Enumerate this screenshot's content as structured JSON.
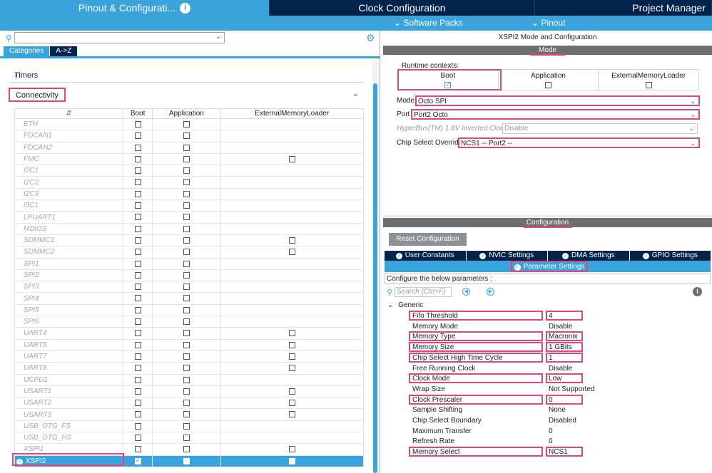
{
  "top_tabs": {
    "pinout": "Pinout & Configurati...",
    "clock": "Clock Configuration",
    "project": "Project Manager"
  },
  "sub_menu": {
    "software_packs": "Software Packs",
    "pinout": "Pinout"
  },
  "left": {
    "category_tabs": [
      "Categories",
      "A->Z"
    ],
    "timers": "Timers",
    "connectivity": "Connectivity",
    "table_headers": [
      "Boot",
      "Application",
      "ExternalMemoryLoader"
    ],
    "rows": [
      {
        "name": "ETH",
        "boot": 0,
        "app": 0,
        "ext": null
      },
      {
        "name": "FDCAN1",
        "boot": 0,
        "app": 0,
        "ext": null
      },
      {
        "name": "FDCAN2",
        "boot": 0,
        "app": 0,
        "ext": null
      },
      {
        "name": "FMC",
        "boot": 0,
        "app": 0,
        "ext": 0
      },
      {
        "name": "I2C1",
        "boot": 0,
        "app": 0,
        "ext": null
      },
      {
        "name": "I2C2",
        "boot": 0,
        "app": 0,
        "ext": null
      },
      {
        "name": "I2C3",
        "boot": 0,
        "app": 0,
        "ext": null
      },
      {
        "name": "I3C1",
        "boot": 0,
        "app": 0,
        "ext": null
      },
      {
        "name": "LPUART1",
        "boot": 0,
        "app": 0,
        "ext": null
      },
      {
        "name": "MDIOS",
        "boot": 0,
        "app": 0,
        "ext": null
      },
      {
        "name": "SDMMC1",
        "boot": 0,
        "app": 0,
        "ext": 0
      },
      {
        "name": "SDMMC2",
        "boot": 0,
        "app": 0,
        "ext": 0
      },
      {
        "name": "SPI1",
        "boot": 0,
        "app": 0,
        "ext": null
      },
      {
        "name": "SPI2",
        "boot": 0,
        "app": 0,
        "ext": null
      },
      {
        "name": "SPI3",
        "boot": 0,
        "app": 0,
        "ext": null
      },
      {
        "name": "SPI4",
        "boot": 0,
        "app": 0,
        "ext": null
      },
      {
        "name": "SPI5",
        "boot": 0,
        "app": 0,
        "ext": null
      },
      {
        "name": "SPI6",
        "boot": 0,
        "app": 0,
        "ext": null
      },
      {
        "name": "UART4",
        "boot": 0,
        "app": 0,
        "ext": 0
      },
      {
        "name": "UART5",
        "boot": 0,
        "app": 0,
        "ext": 0
      },
      {
        "name": "UART7",
        "boot": 0,
        "app": 0,
        "ext": 0
      },
      {
        "name": "UART8",
        "boot": 0,
        "app": 0,
        "ext": 0
      },
      {
        "name": "UCPD1",
        "boot": 0,
        "app": 0,
        "ext": null
      },
      {
        "name": "USART1",
        "boot": 0,
        "app": 0,
        "ext": 0
      },
      {
        "name": "USART2",
        "boot": 0,
        "app": 0,
        "ext": 0
      },
      {
        "name": "USART3",
        "boot": 0,
        "app": 0,
        "ext": 0
      },
      {
        "name": "USB_OTG_FS",
        "boot": 0,
        "app": 0,
        "ext": null
      },
      {
        "name": "USB_OTG_HS",
        "boot": 0,
        "app": 0,
        "ext": null
      },
      {
        "name": "XSPI1",
        "boot": 0,
        "app": 0,
        "ext": 0
      },
      {
        "name": "XSPI2",
        "boot": 1,
        "app": 0,
        "ext": 0,
        "selected": true
      }
    ]
  },
  "right": {
    "title": "XSPI2 Mode and Configuration",
    "mode_band": "Mode",
    "runtime_label": "Runtime contexts:",
    "contexts": [
      {
        "label": "Boot",
        "checked": true
      },
      {
        "label": "Application",
        "checked": false
      },
      {
        "label": "ExternalMemoryLoader",
        "checked": false
      }
    ],
    "mode_label": "Mode",
    "mode_value": "Octo SPI",
    "port_label": "Port",
    "port_value": "Port2 Octo",
    "hyperbus_label": "HyperBus(TM) 1.8V Inverted Clock",
    "hyperbus_value": "Disable",
    "cs_override_label": "Chip Select Override",
    "cs_override_value": "NCS1 -- Port2 --",
    "config_band": "Configuration",
    "reset_button": "Reset Configuration",
    "tabs": [
      "User Constants",
      "NVIC Settings",
      "DMA Settings",
      "GPIO Settings"
    ],
    "param_tab": "Parameter Settings",
    "configure_label": "Configure the below parameters :",
    "search_placeholder": "Search (Ctrl+F)",
    "generic": "Generic",
    "params": [
      {
        "name": "Fifo Threshold",
        "value": "4",
        "hl": true
      },
      {
        "name": "Memory Mode",
        "value": "Disable",
        "hl": false
      },
      {
        "name": "Memory Type",
        "value": "Macronix",
        "hl": true
      },
      {
        "name": "Memory Size",
        "value": "1 GBits",
        "hl": true
      },
      {
        "name": "Chip Select High Time Cycle",
        "value": "1",
        "hl": true
      },
      {
        "name": "Free Running Clock",
        "value": "Disable",
        "hl": false
      },
      {
        "name": "Clock Mode",
        "value": "Low",
        "hl": true
      },
      {
        "name": "Wrap Size",
        "value": "Not Supported",
        "hl": false
      },
      {
        "name": "Clock Prescaler",
        "value": "0",
        "hl": true
      },
      {
        "name": "Sample Shifting",
        "value": "None",
        "hl": false
      },
      {
        "name": "Chip Select Boundary",
        "value": "Disabled",
        "hl": false
      },
      {
        "name": "Maximum Transfer",
        "value": "0",
        "hl": false
      },
      {
        "name": "Refresh Rate",
        "value": "0",
        "hl": false
      },
      {
        "name": "Memory Select",
        "value": "NCS1",
        "hl": true
      }
    ]
  }
}
